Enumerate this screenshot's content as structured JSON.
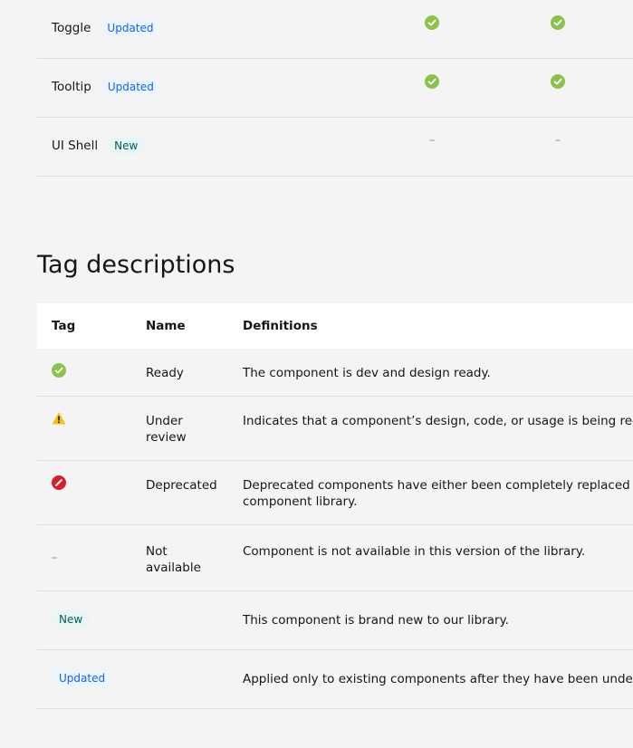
{
  "status_rows": [
    {
      "name": "Toggle",
      "tag": "Updated",
      "tag_type": "updated",
      "col1": "ready-icon",
      "col2": "ready-icon"
    },
    {
      "name": "Tooltip",
      "tag": "Updated",
      "tag_type": "updated",
      "col1": "ready-icon",
      "col2": "ready-icon"
    },
    {
      "name": "UI Shell",
      "tag": "New",
      "tag_type": "new",
      "col1": "not-available-icon",
      "col2": "not-available-icon"
    }
  ],
  "section_title": "Tag descriptions",
  "desc_table": {
    "headers": {
      "tag": "Tag",
      "name": "Name",
      "definitions": "Definitions"
    },
    "rows": [
      {
        "tag_icon": "ready-icon",
        "name": "Ready",
        "definition": "The component is dev and design ready."
      },
      {
        "tag_icon": "under-review-icon",
        "name": "Under review",
        "name_lines": [
          "Under",
          "review"
        ],
        "definition": "Indicates that a component’s design, code, or usage is being re-exa"
      },
      {
        "tag_icon": "deprecated-icon",
        "name": "Deprecated",
        "definition": "Deprecated components have either been completely replaced by n",
        "definition_line2": "component library."
      },
      {
        "tag_icon": "not-available-icon",
        "name": "Not available",
        "name_lines": [
          "Not",
          "available"
        ],
        "definition": "Component is not available in this version of the library."
      },
      {
        "tag_label": "New",
        "name": "",
        "definition": "This component is brand new to our library."
      },
      {
        "tag_label": "Updated",
        "name": "",
        "definition": "Applied only to existing components after they have been under rev"
      }
    ]
  },
  "colors": {
    "ready": "#8bc34a",
    "warning": "#f1c21b",
    "deprecated": "#da1e28",
    "updated_bg": "#edf5ff",
    "updated_text": "#0f62fe",
    "new_bg": "#e8f7f6",
    "new_text": "#005d5d"
  }
}
